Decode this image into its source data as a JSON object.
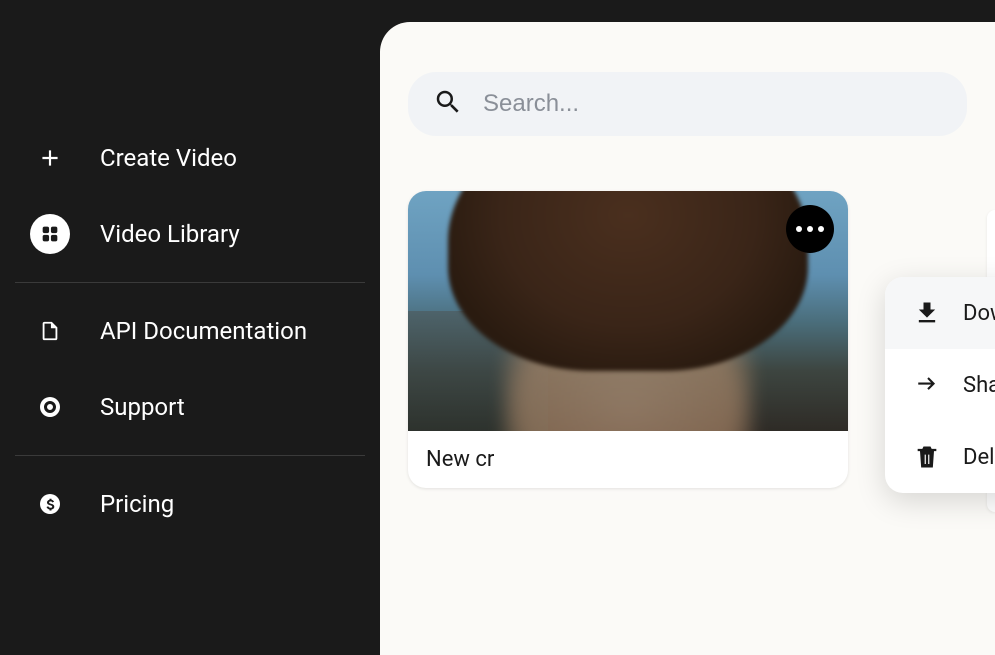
{
  "sidebar": {
    "items": [
      {
        "label": "Create Video"
      },
      {
        "label": "Video Library"
      },
      {
        "label": "API Documentation"
      },
      {
        "label": "Support"
      },
      {
        "label": "Pricing"
      }
    ]
  },
  "search": {
    "placeholder": "Search..."
  },
  "card": {
    "title": "New cr"
  },
  "menu": {
    "download": "Download",
    "share": "Share",
    "delete": "Delete"
  }
}
